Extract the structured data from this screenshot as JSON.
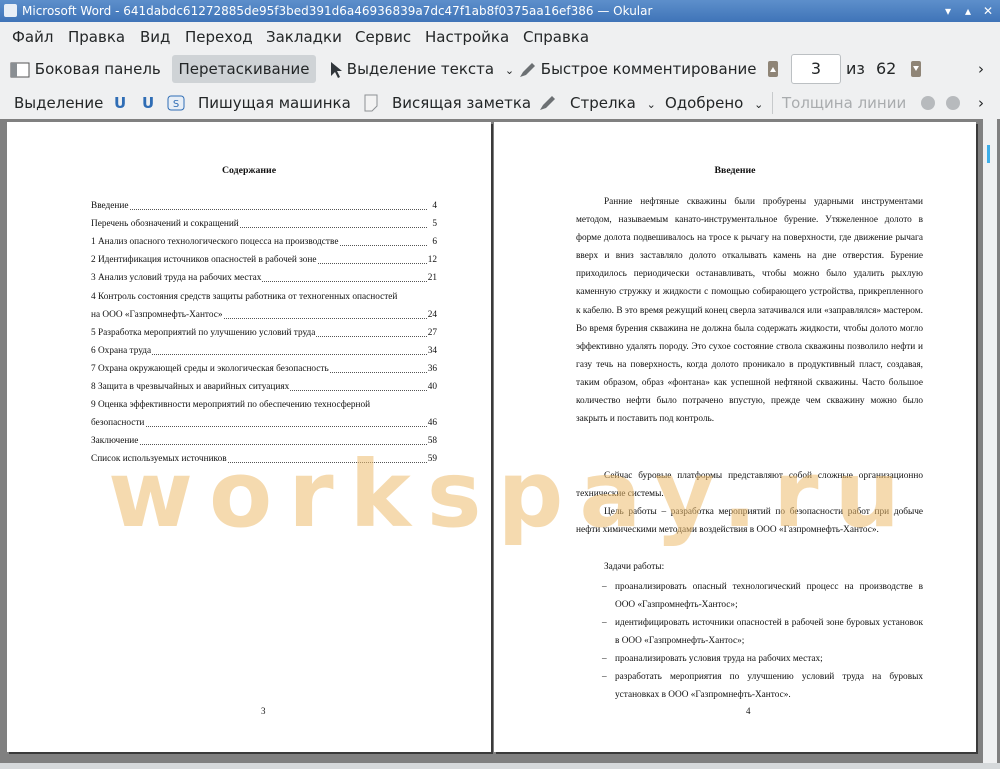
{
  "window": {
    "title": "Microsoft Word - 641dabdc61272885de95f3bed391d6a46936839a7dc47f1ab8f0375aa16ef386  — Okular"
  },
  "menu": [
    "Файл",
    "Правка",
    "Вид",
    "Переход",
    "Закладки",
    "Сервис",
    "Настройка",
    "Справка"
  ],
  "toolbar1": {
    "sidebar": "Боковая панель",
    "drag": "Перетаскивание",
    "text_select": "Выделение текста",
    "quick_comment": "Быстрое комментирование",
    "page_current": "3",
    "page_of": "из",
    "page_total": "62"
  },
  "toolbar2": {
    "highlight": "Выделение",
    "typewriter": "Пишущая машинка",
    "sticky_note": "Висящая заметка",
    "arrow": "Стрелка",
    "approved": "Одобрено",
    "line_width": "Толщина линии"
  },
  "left_page": {
    "heading": "Содержание",
    "toc": [
      {
        "text": "Введение",
        "page": "4"
      },
      {
        "text": "Перечень обозначений и сокращений",
        "page": "5"
      },
      {
        "text": "1 Анализ опасного технологического поцесса на производстве",
        "page": "6"
      },
      {
        "text": "2 Идентификация источников опасностей в рабочей зоне",
        "page": "12"
      },
      {
        "text": "3 Анализ условий труда на рабочих местах",
        "page": "21"
      },
      {
        "text": "4 Контроль состояния средств защиты работника от техногенных опасностей",
        "page": ""
      },
      {
        "text": "на ООО «Газпромнефть-Хантос»",
        "page": "24"
      },
      {
        "text": "5 Разработка мероприятий по улучшению условий труда",
        "page": "27"
      },
      {
        "text": "6 Охрана труда",
        "page": "34"
      },
      {
        "text": "7 Охрана окружающей среды и экологическая безопасность",
        "page": "36"
      },
      {
        "text": "8 Защита в чрезвычайных и аварийных ситуациях",
        "page": "40"
      },
      {
        "text": "9  Оценка  эффективности  мероприятий  по  обеспечению  техносферной",
        "page": ""
      },
      {
        "text": "безопасности",
        "page": "46"
      },
      {
        "text": "Заключение",
        "page": "58"
      },
      {
        "text": "Список используемых источников",
        "page": "59"
      }
    ],
    "page_number": "3"
  },
  "right_page": {
    "heading": "Введение",
    "para1": "Ранние нефтяные скважины были пробурены ударными инструментами методом, называемым канато-инструментальное бурение. Утяжеленное долото в форме долота подвешивалось на тросе к рычагу на поверхности, где движение рычага вверх и вниз заставляло долото откалывать камень на дне отверстия. Бурение приходилось периодически останавливать, чтобы можно было удалить рыхлую каменную стружку и жидкости с помощью собирающего устройства, прикрепленного к кабелю. В это время режущий конец сверла затачивался или «заправлялся» мастером. Во время бурения скважина не должна была содержать жидкости, чтобы долото могло эффективно удалять породу. Это сухое состояние ствола скважины позволило нефти и газу течь на поверхность, когда долото проникало в продуктивный пласт, создавая, таким образом, образ «фонтана» как успешной нефтяной скважины. Часто большое количество нефти было потрачено впустую, прежде чем скважину можно было закрыть и поставить под контроль.",
    "para2": "Сейчас буровые платформы представляют собой сложные организационно технические системы.",
    "para3": "Цель работы – разработка мероприятий по безопасности работ при добыче нефти химическими методами воздействия в ООО «Газпромнефть-Хантос».",
    "tasks_label": "Задачи работы:",
    "tasks": [
      "проанализировать опасный технологический процесс на производстве в ООО «Газпромнефть-Хантос»;",
      "идентифицировать источники опасностей в рабочей зоне буровых установок в ООО «Газпромнефть-Хантос»;",
      "проанализировать условия труда на рабочих местах;",
      "разработать мероприятия по улучшению условий труда на буровых установках в ООО «Газпромнефть-Хантос»."
    ],
    "page_number": "4"
  },
  "watermark": "workspay.ru"
}
